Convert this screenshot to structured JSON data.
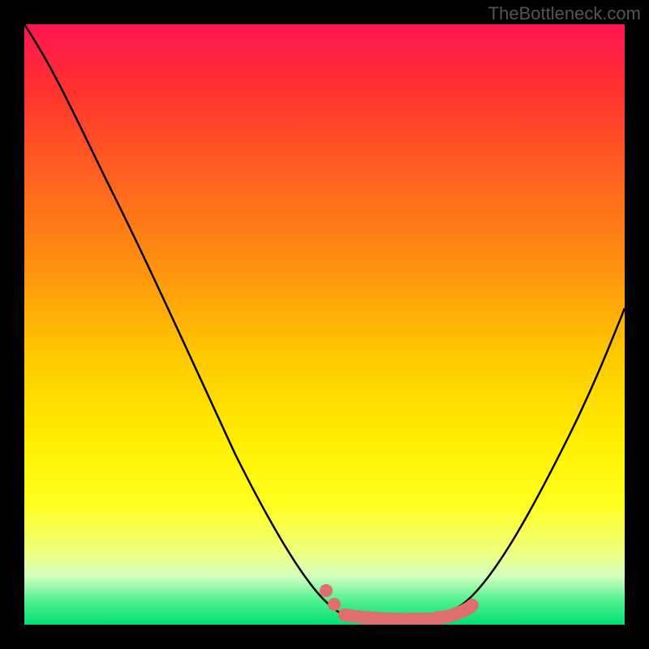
{
  "watermark": "TheBottleneck.com",
  "chart_data": {
    "type": "line",
    "title": "",
    "xlabel": "",
    "ylabel": "",
    "xlim": [
      0,
      100
    ],
    "ylim": [
      0,
      100
    ],
    "series": [
      {
        "name": "curve",
        "x": [
          0,
          10,
          20,
          30,
          40,
          48,
          52,
          55,
          60,
          65,
          70,
          75,
          80,
          90,
          100
        ],
        "y": [
          100,
          80,
          60,
          40,
          20,
          6,
          2,
          0.5,
          0,
          0,
          0.5,
          2,
          8,
          25,
          45
        ]
      }
    ],
    "markers": {
      "name": "highlight-band",
      "color": "#e07070",
      "x_range": [
        52,
        75
      ],
      "y": 0
    }
  }
}
